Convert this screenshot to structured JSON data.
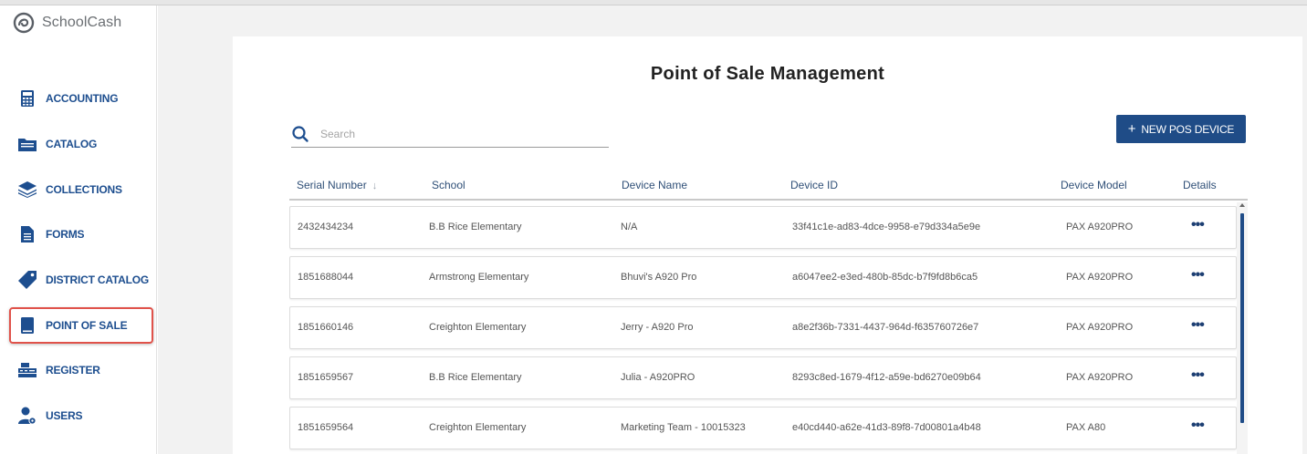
{
  "app": {
    "brand": "SchoolCash"
  },
  "sidebar": {
    "items": [
      {
        "label": "ACCOUNTING",
        "icon": "calculator-icon"
      },
      {
        "label": "CATALOG",
        "icon": "folder-icon"
      },
      {
        "label": "COLLECTIONS",
        "icon": "layers-icon"
      },
      {
        "label": "FORMS",
        "icon": "document-icon"
      },
      {
        "label": "DISTRICT CATALOG",
        "icon": "tag-icon"
      },
      {
        "label": "POINT OF SALE",
        "icon": "tablet-icon",
        "active": true
      },
      {
        "label": "REGISTER",
        "icon": "register-icon"
      },
      {
        "label": "USERS",
        "icon": "user-gear-icon"
      }
    ]
  },
  "page": {
    "title": "Point of Sale Management",
    "search": {
      "placeholder": "Search",
      "value": ""
    },
    "new_button_label": "NEW POS DEVICE"
  },
  "table": {
    "columns": [
      "Serial Number",
      "School",
      "Device Name",
      "Device ID",
      "Device Model",
      "Details"
    ],
    "rows": [
      {
        "serial": "2432434234",
        "school": "B.B Rice Elementary",
        "device_name": "N/A",
        "device_id": "33f41c1e-ad83-4dce-9958-e79d334a5e9e",
        "model": "PAX A920PRO"
      },
      {
        "serial": "1851688044",
        "school": "Armstrong Elementary",
        "device_name": "Bhuvi's A920 Pro",
        "device_id": "a6047ee2-e3ed-480b-85dc-b7f9fd8b6ca5",
        "model": "PAX A920PRO"
      },
      {
        "serial": "1851660146",
        "school": "Creighton Elementary",
        "device_name": "Jerry - A920 Pro",
        "device_id": "a8e2f36b-7331-4437-964d-f635760726e7",
        "model": "PAX A920PRO"
      },
      {
        "serial": "1851659567",
        "school": "B.B Rice Elementary",
        "device_name": "Julia - A920PRO",
        "device_id": "8293c8ed-1679-4f12-a59e-bd6270e09b64",
        "model": "PAX A920PRO"
      },
      {
        "serial": "1851659564",
        "school": "Creighton Elementary",
        "device_name": "Marketing Team - 10015323",
        "device_id": "e40cd440-a62e-41d3-89f8-7d00801a4b48",
        "model": "PAX A80"
      }
    ]
  },
  "colors": {
    "primary": "#1f4c87",
    "nav_text": "#1d4e8f",
    "active_outline": "#e0524a"
  }
}
